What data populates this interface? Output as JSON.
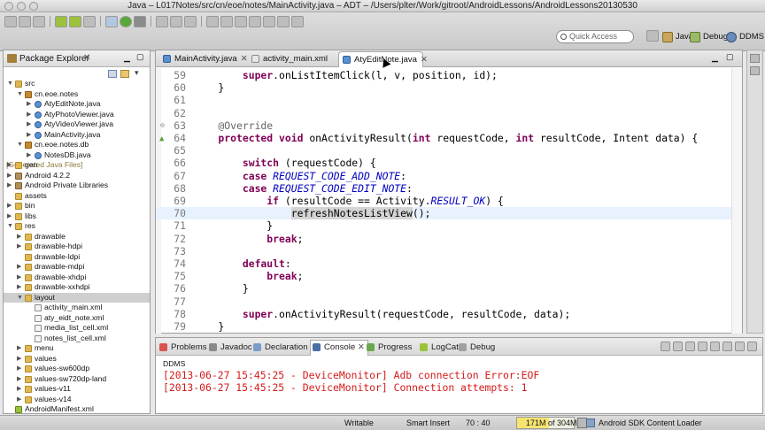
{
  "window": {
    "title": "Java – L017Notes/src/cn/eoe/notes/MainActivity.java – ADT – /Users/plter/Work/gitroot/AndroidLessons/AndroidLessons20130530"
  },
  "toolbar": {
    "quick_access_placeholder": "Quick Access",
    "perspectives": [
      {
        "label": "Java",
        "icon": "java-perspective-icon",
        "active": true
      },
      {
        "label": "Debug",
        "icon": "debug-perspective-icon",
        "active": false
      },
      {
        "label": "DDMS",
        "icon": "ddms-perspective-icon",
        "active": false
      }
    ]
  },
  "package_explorer": {
    "title": "Package Explorer",
    "items": [
      {
        "label": "src",
        "icon": "folder",
        "depth": 1,
        "expanded": true,
        "cut": true
      },
      {
        "label": "cn.eoe.notes",
        "icon": "package",
        "depth": 2,
        "expanded": true
      },
      {
        "label": "AtyEditNote.java",
        "icon": "java",
        "depth": 3
      },
      {
        "label": "AtyPhotoViewer.java",
        "icon": "java",
        "depth": 3
      },
      {
        "label": "AtyVideoViewer.java",
        "icon": "java",
        "depth": 3
      },
      {
        "label": "MainActivity.java",
        "icon": "java",
        "depth": 3
      },
      {
        "label": "cn.eoe.notes.db",
        "icon": "package",
        "depth": 2,
        "expanded": true
      },
      {
        "label": "NotesDB.java",
        "icon": "java",
        "depth": 3
      },
      {
        "label": "gen",
        "suffix": "[Generated Java Files]",
        "icon": "folder",
        "depth": 1
      },
      {
        "label": "Android 4.2.2",
        "icon": "library",
        "depth": 1
      },
      {
        "label": "Android Private Libraries",
        "icon": "library",
        "depth": 1
      },
      {
        "label": "assets",
        "icon": "folder",
        "depth": 1,
        "leaf": true
      },
      {
        "label": "bin",
        "icon": "folder",
        "depth": 1
      },
      {
        "label": "libs",
        "icon": "folder",
        "depth": 1
      },
      {
        "label": "res",
        "icon": "folder",
        "depth": 1,
        "expanded": true
      },
      {
        "label": "drawable",
        "icon": "folder",
        "depth": 2
      },
      {
        "label": "drawable-hdpi",
        "icon": "folder",
        "depth": 2
      },
      {
        "label": "drawable-ldpi",
        "icon": "folder",
        "depth": 2,
        "leaf": true
      },
      {
        "label": "drawable-mdpi",
        "icon": "folder",
        "depth": 2
      },
      {
        "label": "drawable-xhdpi",
        "icon": "folder",
        "depth": 2
      },
      {
        "label": "drawable-xxhdpi",
        "icon": "folder",
        "depth": 2
      },
      {
        "label": "layout",
        "icon": "folder",
        "depth": 2,
        "expanded": true,
        "selected": true
      },
      {
        "label": "activity_main.xml",
        "icon": "xml",
        "depth": 3
      },
      {
        "label": "aty_eidt_note.xml",
        "icon": "xml",
        "depth": 3
      },
      {
        "label": "media_list_cell.xml",
        "icon": "xml",
        "depth": 3
      },
      {
        "label": "notes_list_cell.xml",
        "icon": "xml",
        "depth": 3
      },
      {
        "label": "menu",
        "icon": "folder",
        "depth": 2
      },
      {
        "label": "values",
        "icon": "folder",
        "depth": 2
      },
      {
        "label": "values-sw600dp",
        "icon": "folder",
        "depth": 2
      },
      {
        "label": "values-sw720dp-land",
        "icon": "folder",
        "depth": 2
      },
      {
        "label": "values-v11",
        "icon": "folder",
        "depth": 2
      },
      {
        "label": "values-v14",
        "icon": "folder",
        "depth": 2
      },
      {
        "label": "AndroidManifest.xml",
        "icon": "android",
        "depth": 1,
        "leaf": true
      }
    ]
  },
  "editor": {
    "tabs": [
      {
        "label": "MainActivity.java",
        "icon": "java",
        "active": false,
        "closable": true
      },
      {
        "label": "activity_main.xml",
        "icon": "xml",
        "active": false,
        "closable": false
      },
      {
        "label": "AtyEditNote.java",
        "icon": "java",
        "active": true,
        "closable": true
      }
    ],
    "lines": [
      {
        "n": "59",
        "code": [
          {
            "t": "        super",
            "c": "kw"
          },
          {
            "t": ".onListItemClick(l, v, position, id);"
          }
        ]
      },
      {
        "n": "60",
        "code": [
          {
            "t": "    }"
          }
        ]
      },
      {
        "n": "61",
        "code": []
      },
      {
        "n": "62",
        "code": []
      },
      {
        "n": "63",
        "code": [
          {
            "t": "    @Override",
            "c": "an"
          }
        ],
        "fold": true
      },
      {
        "n": "64",
        "code": [
          {
            "t": "    protected void ",
            "c": "kw"
          },
          {
            "t": "onActivityResult("
          },
          {
            "t": "int ",
            "c": "kw"
          },
          {
            "t": "requestCode, "
          },
          {
            "t": "int ",
            "c": "kw"
          },
          {
            "t": "resultCode, Intent data) {"
          }
        ],
        "marker": true
      },
      {
        "n": "65",
        "code": []
      },
      {
        "n": "66",
        "code": [
          {
            "t": "        switch ",
            "c": "kw"
          },
          {
            "t": "(requestCode) {"
          }
        ]
      },
      {
        "n": "67",
        "code": [
          {
            "t": "        case ",
            "c": "kw"
          },
          {
            "t": "REQUEST_CODE_ADD_NOTE",
            "c": "cn"
          },
          {
            "t": ":"
          }
        ]
      },
      {
        "n": "68",
        "code": [
          {
            "t": "        case ",
            "c": "kw"
          },
          {
            "t": "REQUEST_CODE_EDIT_NOTE",
            "c": "cn"
          },
          {
            "t": ":"
          }
        ]
      },
      {
        "n": "69",
        "code": [
          {
            "t": "            if ",
            "c": "kw"
          },
          {
            "t": "(resultCode == Activity."
          },
          {
            "t": "RESULT_OK",
            "c": "cn"
          },
          {
            "t": ") {"
          }
        ]
      },
      {
        "n": "70",
        "code": [
          {
            "t": "                "
          },
          {
            "t": "refreshNotesListView",
            "c": "mark"
          },
          {
            "t": "();"
          }
        ],
        "current": true
      },
      {
        "n": "71",
        "code": [
          {
            "t": "            }"
          }
        ]
      },
      {
        "n": "72",
        "code": [
          {
            "t": "            break",
            "c": "kw"
          },
          {
            "t": ";"
          }
        ]
      },
      {
        "n": "73",
        "code": []
      },
      {
        "n": "74",
        "code": [
          {
            "t": "        default",
            "c": "kw"
          },
          {
            "t": ":"
          }
        ]
      },
      {
        "n": "75",
        "code": [
          {
            "t": "            break",
            "c": "kw"
          },
          {
            "t": ";"
          }
        ]
      },
      {
        "n": "76",
        "code": [
          {
            "t": "        }"
          }
        ]
      },
      {
        "n": "77",
        "code": []
      },
      {
        "n": "78",
        "code": [
          {
            "t": "        super",
            "c": "kw"
          },
          {
            "t": ".onActivityResult(requestCode, resultCode, data);"
          }
        ]
      },
      {
        "n": "79",
        "code": [
          {
            "t": "    }"
          }
        ]
      }
    ]
  },
  "console": {
    "tabs": [
      {
        "label": "Problems",
        "icon": "problems-icon",
        "color": "#d9534f"
      },
      {
        "label": "Javadoc",
        "icon": "javadoc-icon",
        "color": "#8a8a8a"
      },
      {
        "label": "Declaration",
        "icon": "declaration-icon",
        "color": "#7a9cc6"
      },
      {
        "label": "Console",
        "icon": "console-icon",
        "color": "#4a6fa5",
        "active": true,
        "closable": true
      },
      {
        "label": "Progress",
        "icon": "progress-icon",
        "color": "#6aa84f"
      },
      {
        "label": "LogCat",
        "icon": "logcat-icon",
        "color": "#9cc23b"
      },
      {
        "label": "Debug",
        "icon": "debug-icon",
        "color": "#a0a0a0"
      }
    ],
    "label": "DDMS",
    "lines": [
      "[2013-06-27 15:45:25 - DeviceMonitor] Adb connection Error:EOF",
      "[2013-06-27 15:45:25 - DeviceMonitor] Connection attempts: 1"
    ]
  },
  "status": {
    "mode": "Writable",
    "insert": "Smart Insert",
    "position": "70 : 40",
    "heap": "171M of 304M",
    "heap_used_mb": 171,
    "heap_total_mb": 304,
    "task": "Android SDK Content Loader"
  }
}
